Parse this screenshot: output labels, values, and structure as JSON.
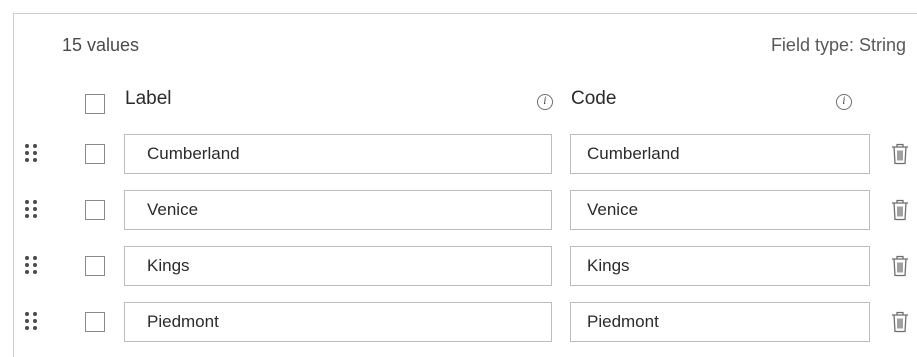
{
  "summary": {
    "values_count": "15 values",
    "field_type": "Field type: String"
  },
  "header": {
    "label": "Label",
    "code": "Code"
  },
  "rows": [
    {
      "label": "Cumberland",
      "code": "Cumberland"
    },
    {
      "label": "Venice",
      "code": "Venice"
    },
    {
      "label": "Kings",
      "code": "Kings"
    },
    {
      "label": "Piedmont",
      "code": "Piedmont"
    }
  ],
  "icons": {
    "info": "info-icon",
    "drag": "drag-handle-icon",
    "delete": "trash-icon"
  },
  "colors": {
    "border": "#bdbdbd",
    "text": "#323232"
  }
}
